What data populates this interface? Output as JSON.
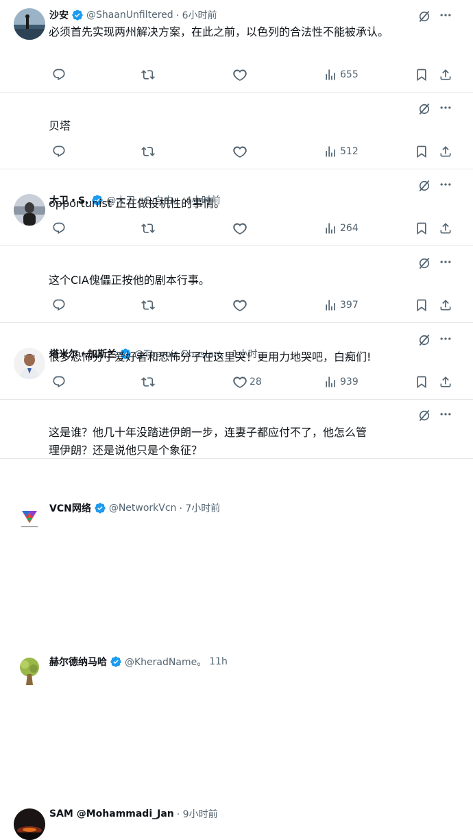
{
  "accent": "#1d9bf0",
  "tweets": [
    {
      "name": "沙安",
      "handle": "@ShaanUnfiltered",
      "time": "· 6小时前",
      "text": "必须首先实现两州解决方案，在此之前，以色列的合法性不能被承认。",
      "text2": "",
      "views": "655",
      "likes": ""
    },
    {
      "name": "大卫・S.",
      "handle": "@大卫・S 自由。",
      "time": "4小时前",
      "text": "贝塔",
      "text2": "",
      "views": "512",
      "likes": ""
    },
    {
      "name": "塔米尔・加斯兰",
      "handle": "@Thamir Ghaslan。",
      "time": "1小时",
      "text": "opportunist 正在做投机性的事情。",
      "text2": "",
      "views": "264",
      "likes": ""
    },
    {
      "name": "VCN网络",
      "handle": "@NetworkVcn",
      "time": "· 7小时前",
      "text": "这个CIA傀儡正按他的剧本行事。",
      "text2": "",
      "views": "397",
      "likes": ""
    },
    {
      "name": "赫尔德纳马哈",
      "handle": "@KheradName。",
      "time": "11h",
      "text": "很多恐怖分子爱好者和恐怖分子在这里哭！更用力地哭吧，白痴们!",
      "text2": "",
      "views": "939",
      "likes": "28"
    },
    {
      "name": "SAM @Mohammadi_Jan",
      "handle": "",
      "time": "· 9小时前",
      "text": "这是谁？他几十年没踏进伊朗一步，连妻子都应付不了，他怎么管",
      "text2": "理伊朗？还是说他只是个象征？",
      "views": "",
      "likes": ""
    }
  ],
  "icons": {
    "reply": "reply-icon",
    "retweet": "retweet-icon",
    "like": "heart-icon",
    "views": "views-chart-icon",
    "bookmark": "bookmark-icon",
    "share": "share-icon",
    "grok": "grok-icon",
    "more": "more-dots-icon"
  }
}
